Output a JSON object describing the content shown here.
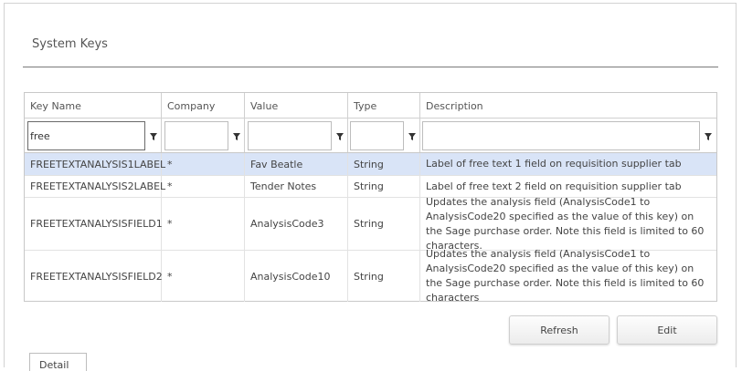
{
  "page": {
    "title": "System Keys"
  },
  "grid": {
    "columns": [
      "Key Name",
      "Company",
      "Value",
      "Type",
      "Description"
    ],
    "filters": {
      "key_name": "free",
      "company": "",
      "value": "",
      "type": "",
      "description": ""
    },
    "rows": [
      {
        "key_name": "FREETEXTANALYSIS1LABEL",
        "company": "*",
        "value": "Fav Beatle",
        "type": "String",
        "description": "Label of free text 1 field on requisition supplier tab"
      },
      {
        "key_name": "FREETEXTANALYSIS2LABEL",
        "company": "*",
        "value": "Tender Notes",
        "type": "String",
        "description": "Label of free text 2 field on requisition supplier tab"
      },
      {
        "key_name": "FREETEXTANALYSISFIELD1",
        "company": "*",
        "value": "AnalysisCode3",
        "type": "String",
        "description": "Updates the analysis field (AnalysisCode1 to AnalysisCode20 specified as the value of this key) on the Sage purchase order. Note this field is limited to 60 characters."
      },
      {
        "key_name": "FREETEXTANALYSISFIELD2",
        "company": "*",
        "value": "AnalysisCode10",
        "type": "String",
        "description": "Updates the analysis field (AnalysisCode1 to AnalysisCode20 specified as the value of this key) on the Sage purchase order. Note this field is limited to 60 characters"
      }
    ]
  },
  "buttons": {
    "refresh": "Refresh",
    "edit": "Edit",
    "detail": "Detail"
  },
  "icons": {
    "filter": "filter-funnel-icon"
  },
  "colors": {
    "selected_row": "#d9e4f7",
    "border": "#c8c8c8"
  }
}
